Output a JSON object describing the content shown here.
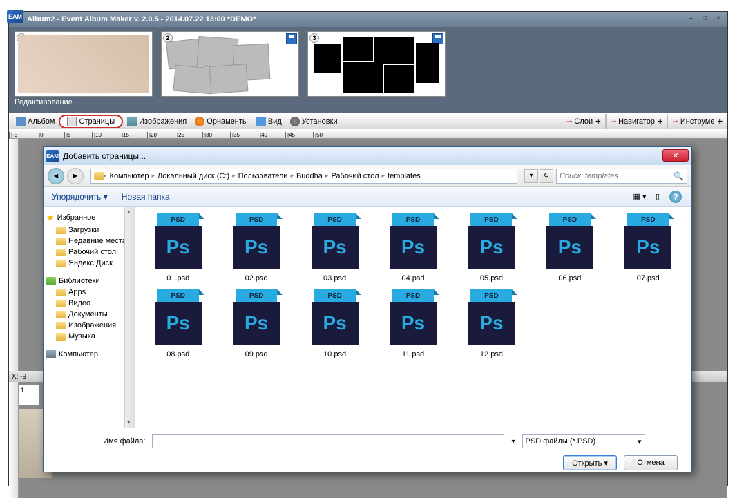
{
  "window": {
    "title": "Album2 - Event Album Maker v. 2.0.5 - 2014.07.22 13:00 *DEMO*",
    "app_badge": "EAM"
  },
  "thumbs": {
    "items": [
      {
        "num": "1",
        "label": "Редактирование"
      },
      {
        "num": "2",
        "label": ""
      },
      {
        "num": "3",
        "label": ""
      }
    ]
  },
  "toolbar": {
    "album": "Альбом",
    "pages": "Страницы",
    "images": "Изображения",
    "ornaments": "Орнаменты",
    "view": "Вид",
    "settings": "Установки",
    "layers": "Слои",
    "navigator": "Навигатор",
    "tools": "Инструме"
  },
  "ruler": {
    "marks": [
      "|-5",
      "|0",
      "|5",
      "|10",
      "|15",
      "|20",
      "|25",
      "|30",
      "|35",
      "|40",
      "|45",
      "|50"
    ],
    "coord": "X: -9"
  },
  "mini": {
    "num": "1"
  },
  "dialog": {
    "title": "Добавить страницы...",
    "app_badge": "EAM",
    "breadcrumbs": [
      "Компьютер",
      "Локальный диск (C:)",
      "Пользователи",
      "Buddha",
      "Рабочий стол",
      "templates"
    ],
    "search_placeholder": "Поиск: templates",
    "organize": "Упорядочить",
    "new_folder": "Новая папка",
    "tree": {
      "favorites": {
        "label": "Избранное",
        "items": [
          "Загрузки",
          "Недавние места",
          "Рабочий стол",
          "Яндекс.Диск"
        ]
      },
      "libraries": {
        "label": "Библиотеки",
        "items": [
          "Apps",
          "Видео",
          "Документы",
          "Изображения",
          "Музыка"
        ]
      },
      "computer": {
        "label": "Компьютер"
      }
    },
    "files": [
      "01.psd",
      "02.psd",
      "03.psd",
      "04.psd",
      "05.psd",
      "06.psd",
      "07.psd",
      "08.psd",
      "09.psd",
      "10.psd",
      "11.psd",
      "12.psd"
    ],
    "footer": {
      "filename_label": "Имя файла:",
      "filter": "PSD файлы (*.PSD)",
      "open": "Открыть",
      "cancel": "Отмена"
    }
  }
}
